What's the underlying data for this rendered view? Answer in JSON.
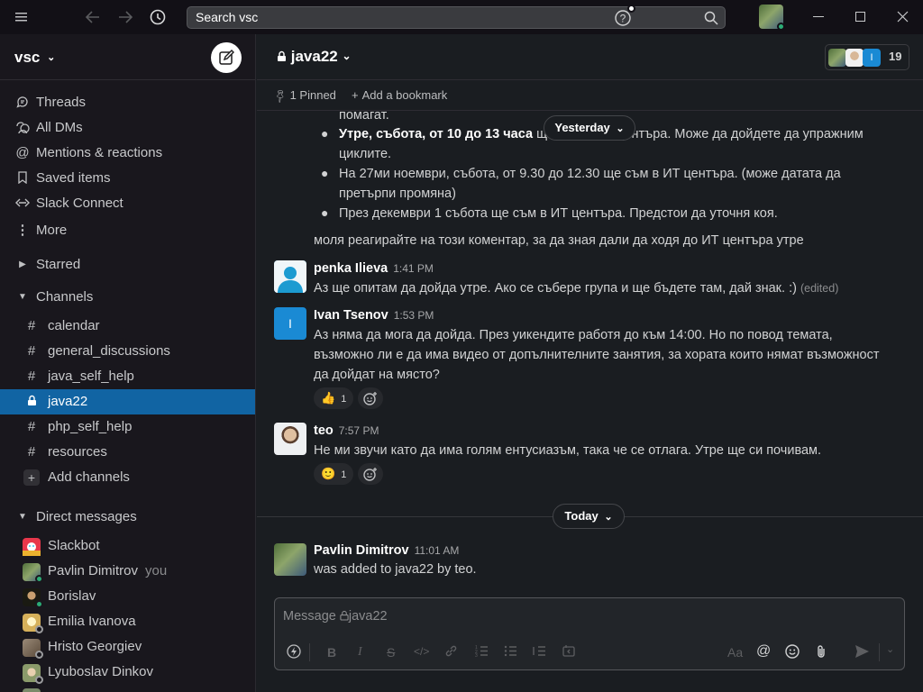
{
  "titlebar": {
    "search_label": "Search vsc"
  },
  "workspace": {
    "name": "vsc"
  },
  "sidebar": {
    "nav": [
      {
        "label": "Threads",
        "icon": "threads-icon"
      },
      {
        "label": "All DMs",
        "icon": "dms-icon"
      },
      {
        "label": "Mentions & reactions",
        "icon": "at-icon"
      },
      {
        "label": "Saved items",
        "icon": "bookmark-icon"
      },
      {
        "label": "Slack Connect",
        "icon": "connect-icon"
      },
      {
        "label": "More",
        "icon": "more-icon"
      }
    ],
    "starred_label": "Starred",
    "channels_label": "Channels",
    "channels": [
      {
        "name": "calendar",
        "prefix": "#"
      },
      {
        "name": "general_discussions",
        "prefix": "#"
      },
      {
        "name": "java_self_help",
        "prefix": "#"
      },
      {
        "name": "java22",
        "prefix": "lock",
        "active": true
      },
      {
        "name": "php_self_help",
        "prefix": "#"
      },
      {
        "name": "resources",
        "prefix": "#"
      }
    ],
    "add_channels_label": "Add channels",
    "dm_label": "Direct messages",
    "dms": [
      {
        "name": "Slackbot",
        "note": "",
        "color": "#e8374b"
      },
      {
        "name": "Pavlin Dimitrov",
        "note": "you",
        "color": "#6a8a56"
      },
      {
        "name": "Borislav",
        "note": "",
        "color": "#3a3a2a"
      },
      {
        "name": "Emilia Ivanova",
        "note": "",
        "color": "#d6b05a"
      },
      {
        "name": "Hristo Georgiev",
        "note": "",
        "color": "#7a6a5a"
      },
      {
        "name": "Lyuboslav Dinkov",
        "note": "",
        "color": "#8a9a6a"
      }
    ]
  },
  "channel": {
    "name": "java22",
    "member_count": "19",
    "pinned_label": "1 Pinned",
    "bookmark_label": "Add a bookmark"
  },
  "messages": {
    "yesterday_label": "Yesterday",
    "today_label": "Today",
    "frag_top": "помагат.",
    "bullets": [
      {
        "bold": "Утре, събота, от 10 до 13 часа",
        "rest": " ще съм в ИТ центъра. Може да дойдете да упражним",
        "cont": "циклите."
      },
      {
        "bold": "",
        "rest": "На 27ми ноември, събота, от 9.30 до 12.30 ще съм в ИТ центъра. (може датата да",
        "cont": "претърпи промяна)"
      },
      {
        "bold": "",
        "rest": "През декември 1 събота ще съм в ИТ центъра. Предстои да уточня коя.",
        "cont": ""
      }
    ],
    "followup": "моля реагирайте на този коментар, за да зная дали да ходя до ИТ центъра утре",
    "penka": {
      "name": "penka Ilieva",
      "time": "1:41 PM",
      "text": "Аз ще опитам да дойда утре. Ако се събере група и ще бъдете там, дай знак. :)",
      "edited": "(edited)"
    },
    "ivan": {
      "name": "Ivan Tsenov",
      "time": "1:53 PM",
      "avatar_letter": "I",
      "line1": "Аз няма да мога да дойда. През уикендите работя до към 14:00. Но по повод темата,",
      "line2": "възможно ли е да има видео от допълнителните занятия, за хората които нямат възможност",
      "line3": "да дойдат на място?",
      "reaction_emoji": "👍",
      "reaction_count": "1"
    },
    "teo": {
      "name": "teo",
      "time": "7:57 PM",
      "text": "Не ми звучи като да има голям ентусиазъм, така че се отлага. Утре ще си почивам.",
      "reaction_emoji": "🙂",
      "reaction_count": "1"
    },
    "pavlin": {
      "name": "Pavlin Dimitrov",
      "time": "11:01 AM",
      "text": "was added to java22 by teo."
    }
  },
  "composer": {
    "placeholder_prefix": "Message ",
    "placeholder_channel": "java22"
  },
  "colors": {
    "accent": "#1164a3",
    "online": "#2bac76",
    "sidebar_bg": "#19171d",
    "main_bg": "#1a1d21"
  }
}
